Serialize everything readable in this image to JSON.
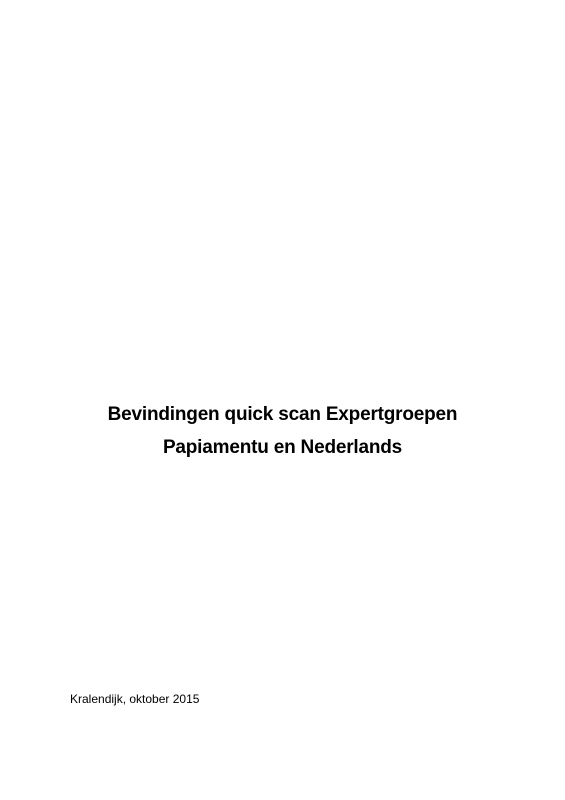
{
  "document": {
    "title_lines": [
      "Bevindingen quick scan Expertgroepen",
      "Papiamentu en Nederlands"
    ],
    "place_date": "Kralendijk, oktober 2015"
  }
}
